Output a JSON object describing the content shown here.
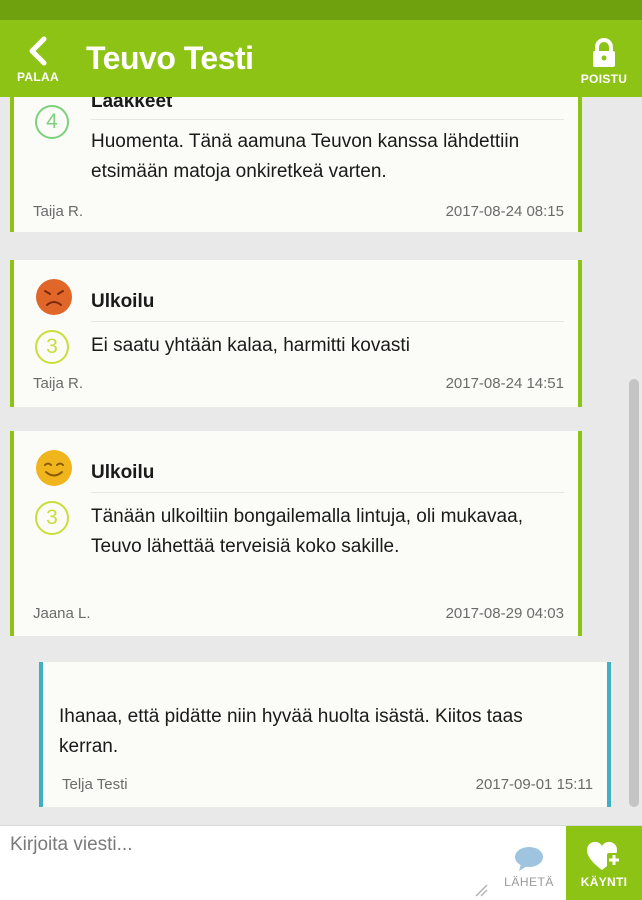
{
  "header": {
    "back_label": "PALAA",
    "title": "Teuvo Testi",
    "logout_label": "POISTU"
  },
  "entries": [
    {
      "kind": "visit",
      "title": "Lääkkeet",
      "level": "4",
      "mood": "none",
      "text": "Huomenta. Tänä aamuna Teuvon kanssa lähdettiin etsimään matoja onkiretkeä varten.",
      "author": "Taija R.",
      "time": "2017-08-24 08:15"
    },
    {
      "kind": "visit",
      "title": "Ulkoilu",
      "level": "3",
      "mood": "sad-face-icon",
      "text": "Ei saatu yhtään kalaa, harmitti kovasti",
      "author": "Taija R.",
      "time": "2017-08-24 14:51"
    },
    {
      "kind": "visit",
      "title": "Ulkoilu",
      "level": "3",
      "mood": "happy-face-icon",
      "text": "Tänään ulkoiltiin bongailemalla lintuja, oli mukavaa, Teuvo lähettää terveisiä koko sakille.",
      "author": "Jaana L.",
      "time": "2017-08-29 04:03"
    },
    {
      "kind": "reply",
      "text": "Ihanaa, että pidätte niin hyvää huolta isästä. Kiitos taas kerran.",
      "author": "Telja Testi",
      "time": "2017-09-01 15:11"
    }
  ],
  "compose": {
    "placeholder": "Kirjoita viesti...",
    "send_label": "LÄHETÄ",
    "visit_label": "KÄYNTI"
  },
  "colors": {
    "brand_green": "#8dc314",
    "reply_teal": "#3fb0c4",
    "sad_face": "#e0662a",
    "happy_face": "#f0b51c",
    "level_3": "#c9de3a",
    "level_4": "#7ed07e"
  }
}
